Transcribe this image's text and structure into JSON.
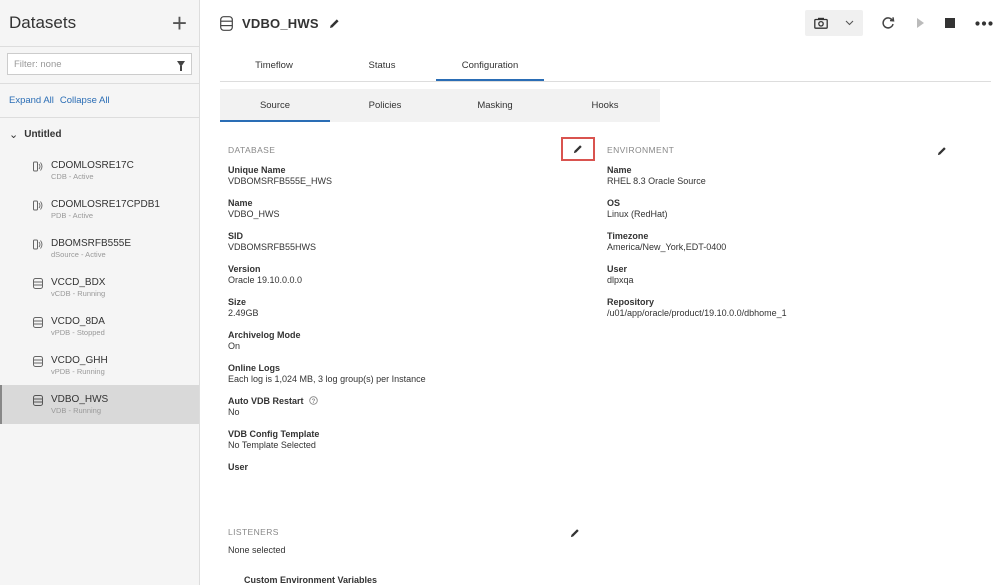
{
  "sidebar": {
    "title": "Datasets",
    "filter_placeholder": "Filter: none",
    "expand_all": "Expand All",
    "collapse_all": "Collapse All",
    "group": "Untitled",
    "items": [
      {
        "name": "CDOMLOSRE17C",
        "status": "CDB - Active",
        "icon": "cdb-icon"
      },
      {
        "name": "CDOMLOSRE17CPDB1",
        "status": "PDB - Active",
        "icon": "cdb-icon"
      },
      {
        "name": "DBOMSRFB555E",
        "status": "dSource - Active",
        "icon": "cdb-icon"
      },
      {
        "name": "VCCD_BDX",
        "status": "vCDB - Running",
        "icon": "database-icon"
      },
      {
        "name": "VCDO_8DA",
        "status": "vPDB - Stopped",
        "icon": "database-icon"
      },
      {
        "name": "VCDO_GHH",
        "status": "vPDB - Running",
        "icon": "database-icon"
      },
      {
        "name": "VDBO_HWS",
        "status": "VDB - Running",
        "icon": "database-icon"
      }
    ]
  },
  "header": {
    "title": "VDBO_HWS"
  },
  "tabs": [
    "Timeflow",
    "Status",
    "Configuration"
  ],
  "subtabs": [
    "Source",
    "Policies",
    "Masking",
    "Hooks"
  ],
  "database": {
    "heading": "DATABASE",
    "fields": [
      {
        "label": "Unique Name",
        "value": "VDBOMSRFB555E_HWS"
      },
      {
        "label": "Name",
        "value": "VDBO_HWS"
      },
      {
        "label": "SID",
        "value": "VDBOMSRFB55HWS"
      },
      {
        "label": "Version",
        "value": "Oracle 19.10.0.0.0"
      },
      {
        "label": "Size",
        "value": "2.49GB"
      },
      {
        "label": "Archivelog Mode",
        "value": "On"
      },
      {
        "label": "Online Logs",
        "value": "Each log is 1,024 MB, 3 log group(s) per Instance"
      },
      {
        "label": "Auto VDB Restart",
        "value": "No"
      },
      {
        "label": "VDB Config Template",
        "value": "No Template Selected"
      },
      {
        "label": "User",
        "value": ""
      }
    ]
  },
  "environment": {
    "heading": "ENVIRONMENT",
    "fields": [
      {
        "label": "Name",
        "value": "RHEL 8.3 Oracle Source"
      },
      {
        "label": "OS",
        "value": "Linux (RedHat)"
      },
      {
        "label": "Timezone",
        "value": "America/New_York,EDT-0400"
      },
      {
        "label": "User",
        "value": "dlpxqa"
      },
      {
        "label": "Repository",
        "value": "/u01/app/oracle/product/19.10.0.0/dbhome_1"
      }
    ]
  },
  "listeners": {
    "heading": "LISTENERS",
    "value": "None selected"
  },
  "custom_env": {
    "heading": "Custom Environment Variables"
  },
  "colors": {
    "accent": "#2a6db5",
    "highlight": "#d9534f"
  }
}
